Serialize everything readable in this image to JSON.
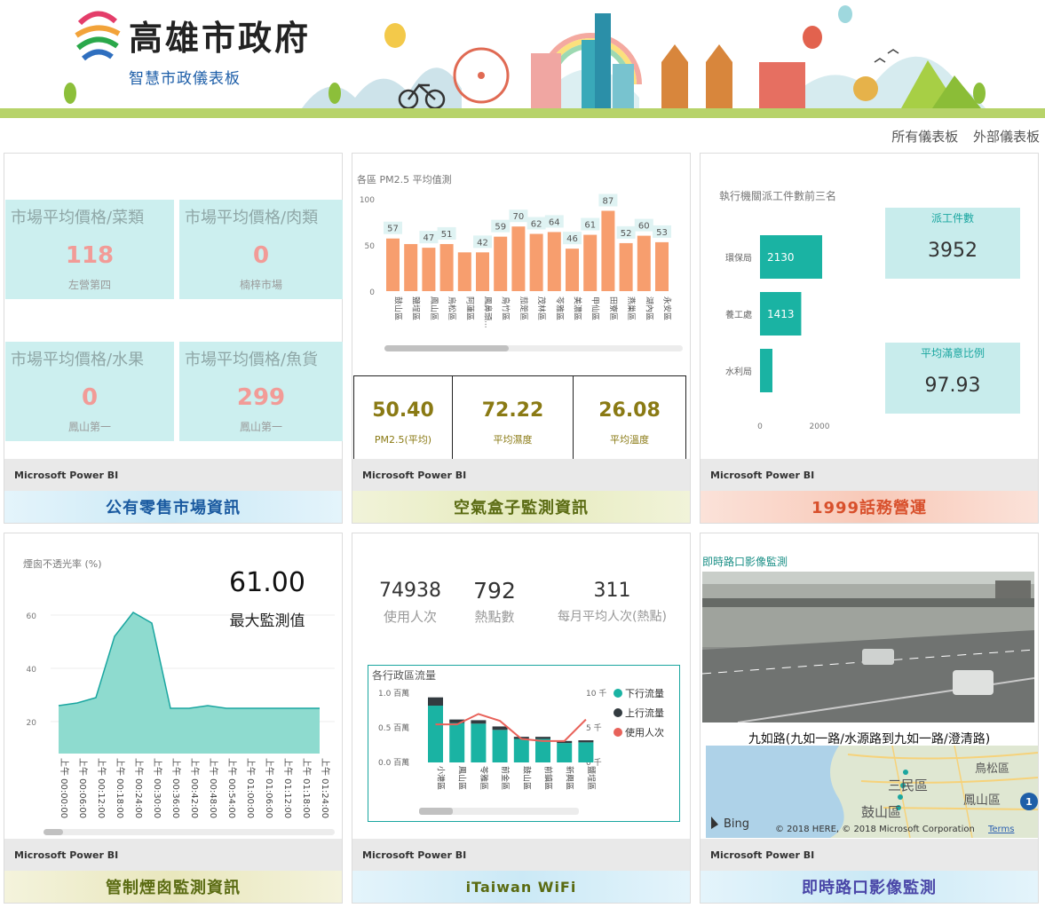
{
  "header": {
    "title": "高雄市政府",
    "subtitle": "智慧市政儀表板"
  },
  "top_links": [
    "所有儀表板",
    "外部儀表板"
  ],
  "powerbi_label": "Microsoft Power BI",
  "market": {
    "cards": [
      {
        "title": "市場平均價格/菜類",
        "value": "118",
        "sub": "左營第四"
      },
      {
        "title": "市場平均價格/肉類",
        "value": "0",
        "sub": "楠梓市場"
      },
      {
        "title": "市場平均價格/水果",
        "value": "0",
        "sub": "鳳山第一"
      },
      {
        "title": "市場平均價格/魚貨",
        "value": "299",
        "sub": "鳳山第一"
      }
    ],
    "banner": "公有零售市場資訊"
  },
  "air": {
    "chart_title": "各區 PM2.5 平均值測",
    "stats": [
      {
        "value": "50.40",
        "label": "PM2.5(平均)"
      },
      {
        "value": "72.22",
        "label": "平均濕度"
      },
      {
        "value": "26.08",
        "label": "平均溫度"
      }
    ],
    "banner": "空氣盒子監測資訊"
  },
  "hotline": {
    "chart_title": "執行機關派工件數前三名",
    "kpis": [
      {
        "label": "派工件數",
        "value": "3952"
      },
      {
        "label": "平均滿意比例",
        "value": "97.93"
      }
    ],
    "banner": "1999話務營運"
  },
  "smoke": {
    "chart_title": "煙囪不透光率 (%)",
    "max_value": "61.00",
    "max_label": "最大監測值",
    "banner": "管制煙囪監測資訊"
  },
  "wifi": {
    "stats": [
      {
        "value": "74938",
        "label": "使用人次"
      },
      {
        "value": "792",
        "label": "熱點數"
      },
      {
        "value": "311",
        "label": "每月平均人次(熱點)"
      }
    ],
    "chart_title": "各行政區流量",
    "legend": [
      "下行流量",
      "上行流量",
      "使用人次"
    ],
    "banner": "iTaiwan WiFi"
  },
  "camera": {
    "title": "即時路口影像監測",
    "caption": "九如路(九如一路/水源路到九如一路/澄清路)",
    "map_labels": [
      "鳥松區",
      "三民區",
      "鳳山區",
      "鼓山區"
    ],
    "map_badge": "1",
    "bing": "Bing",
    "copyright": "© 2018 HERE, © 2018 Microsoft Corporation",
    "terms": "Terms",
    "banner": "即時路口影像監測"
  },
  "colors": {
    "cyan": "#c8ecec",
    "teal": "#1ab3a3",
    "orange": "#f79e6e",
    "gold": "#8a7a14"
  },
  "chart_data": [
    {
      "type": "bar",
      "title": "各區 PM2.5 平均值測",
      "categories": [
        "鼓山區",
        "鹽埕區",
        "鳳山區",
        "烏松區",
        "阿蓮區",
        "鳳鼻頭...",
        "鳥竹區",
        "茄萣區",
        "茂林區",
        "苓雅區",
        "美濃區",
        "甲仙區",
        "田寮區",
        "燕巢區",
        "湖內區",
        "永安區"
      ],
      "values": [
        57,
        51,
        47,
        51,
        42,
        42,
        59,
        70,
        62,
        64,
        46,
        61,
        87,
        52,
        60,
        53
      ],
      "data_labels": [
        57,
        null,
        47,
        51,
        null,
        42,
        59,
        70,
        62,
        64,
        46,
        61,
        87,
        52,
        60,
        53
      ],
      "ylim": [
        0,
        100
      ],
      "yticks": [
        0,
        50,
        100
      ]
    },
    {
      "type": "bar",
      "title": "執行機關派工件數前三名",
      "categories": [
        "環保局",
        "養工處",
        "水利局"
      ],
      "values": [
        2130,
        1413,
        409
      ],
      "data_labels": [
        "2130",
        "1413",
        ""
      ],
      "xticks": [
        0,
        2000
      ],
      "orientation": "horizontal"
    },
    {
      "type": "area",
      "title": "煙囪不透光率 (%)",
      "x": [
        "上午 00:00:00",
        "上午 00:06:00",
        "上午 00:12:00",
        "上午 00:18:00",
        "上午 00:24:00",
        "上午 00:30:00",
        "上午 00:36:00",
        "上午 00:42:00",
        "上午 00:48:00",
        "上午 00:54:00",
        "上午 01:00:00",
        "上午 01:06:00",
        "上午 01:12:00",
        "上午 01:18:00",
        "上午 01:24:00"
      ],
      "values": [
        26,
        27,
        29,
        52,
        61,
        57,
        25,
        25,
        26,
        25,
        25,
        25,
        25,
        25,
        25
      ],
      "yticks": [
        20,
        40,
        60
      ],
      "ylim": [
        8,
        68
      ]
    },
    {
      "type": "bar",
      "title": "各行政區流量",
      "categories": [
        "小港區",
        "鳳山區",
        "苓雅區",
        "前金區",
        "鼓山區",
        "前鎮區",
        "新興區",
        "鹽埕區"
      ],
      "series": [
        {
          "name": "下行流量",
          "values": [
            0.82,
            0.57,
            0.56,
            0.47,
            0.34,
            0.34,
            0.28,
            0.29
          ]
        },
        {
          "name": "上行流量",
          "values": [
            0.12,
            0.05,
            0.05,
            0.05,
            0.03,
            0.03,
            0.03,
            0.03
          ]
        },
        {
          "name": "使用人次",
          "values": [
            5.5,
            5.5,
            7.0,
            6.0,
            3.4,
            3.1,
            3.1,
            6.2
          ]
        }
      ],
      "yticks_left": [
        "0.0 百萬",
        "0.5 百萬",
        "1.0 百萬"
      ],
      "yticks_right": [
        "0 千",
        "5 千",
        "10 千"
      ]
    }
  ]
}
